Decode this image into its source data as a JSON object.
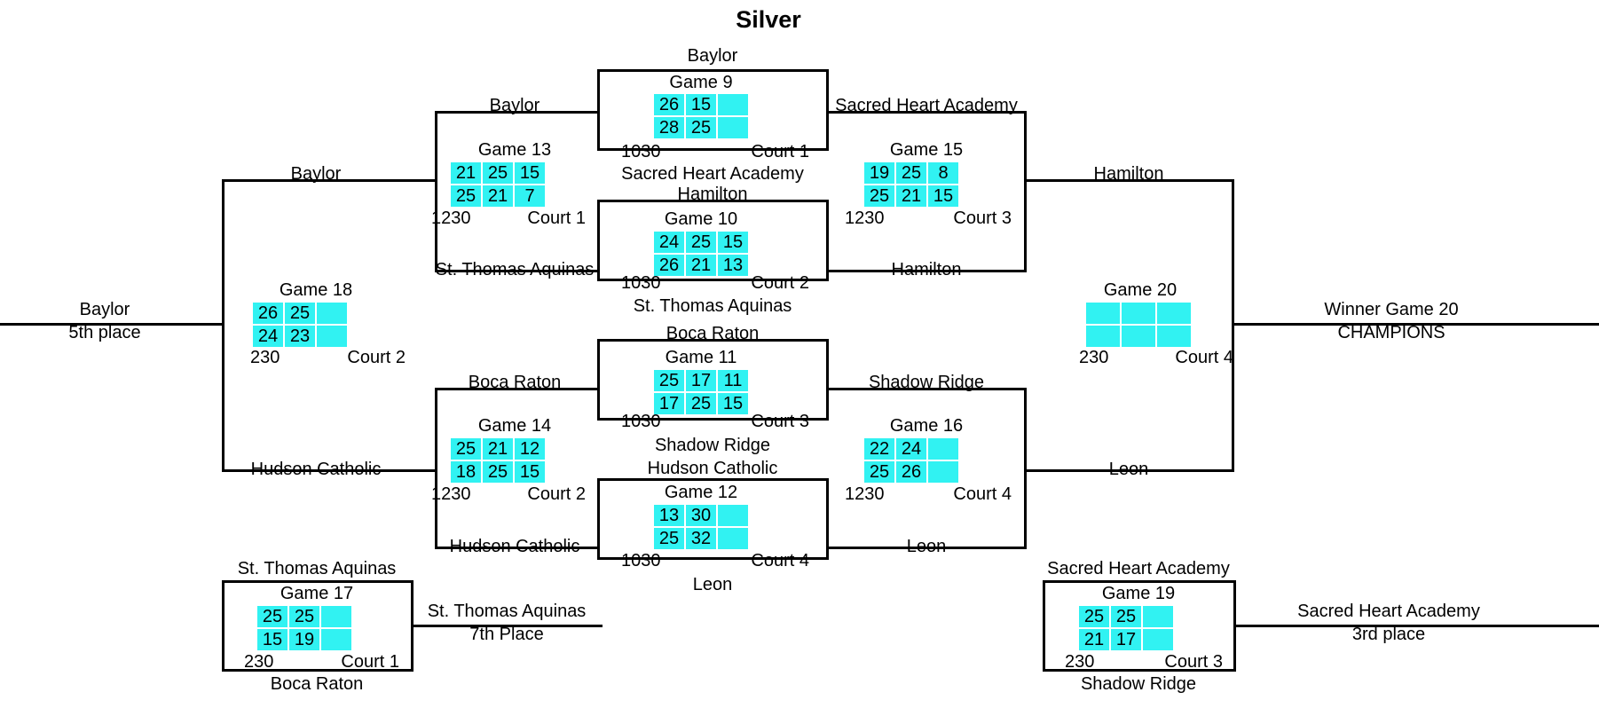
{
  "bracket": {
    "title": "Silver",
    "games": [
      {
        "id": "game-9",
        "label": "Game 9",
        "top_team": "Baylor",
        "bottom_team": "Sacred Heart Academy",
        "time": "1030",
        "court": "Court 1",
        "scores_top": [
          "26",
          "15",
          ""
        ],
        "scores_bottom": [
          "28",
          "25",
          ""
        ]
      },
      {
        "id": "game-10",
        "label": "Game 10",
        "top_team": "Hamilton",
        "bottom_team": "St. Thomas Aquinas",
        "time": "1030",
        "court": "Court 2",
        "scores_top": [
          "24",
          "25",
          "15"
        ],
        "scores_bottom": [
          "26",
          "21",
          "13"
        ]
      },
      {
        "id": "game-11",
        "label": "Game 11",
        "top_team": "Boca Raton",
        "bottom_team": "Shadow Ridge",
        "time": "1030",
        "court": "Court 3",
        "scores_top": [
          "25",
          "17",
          "11"
        ],
        "scores_bottom": [
          "17",
          "25",
          "15"
        ]
      },
      {
        "id": "game-12",
        "label": "Game 12",
        "top_team": "Hudson Catholic",
        "bottom_team": "Leon",
        "time": "1030",
        "court": "Court 4",
        "scores_top": [
          "13",
          "30",
          ""
        ],
        "scores_bottom": [
          "25",
          "32",
          ""
        ]
      },
      {
        "id": "game-13",
        "label": "Game 13",
        "top_team": "Baylor",
        "bottom_team": "St. Thomas Aquinas",
        "time": "1230",
        "court": "Court 1",
        "scores_top": [
          "21",
          "25",
          "15"
        ],
        "scores_bottom": [
          "25",
          "21",
          "7"
        ]
      },
      {
        "id": "game-14",
        "label": "Game 14",
        "top_team": "Boca Raton",
        "bottom_team": "Hudson Catholic",
        "time": "1230",
        "court": "Court 2",
        "scores_top": [
          "25",
          "21",
          "12"
        ],
        "scores_bottom": [
          "18",
          "25",
          "15"
        ]
      },
      {
        "id": "game-15",
        "label": "Game 15",
        "top_team": "Sacred Heart Academy",
        "bottom_team": "Hamilton",
        "time": "1230",
        "court": "Court 3",
        "scores_top": [
          "19",
          "25",
          "8"
        ],
        "scores_bottom": [
          "25",
          "21",
          "15"
        ]
      },
      {
        "id": "game-16",
        "label": "Game 16",
        "top_team": "Shadow Ridge",
        "bottom_team": "Leon",
        "time": "1230",
        "court": "Court 4",
        "scores_top": [
          "22",
          "24",
          ""
        ],
        "scores_bottom": [
          "25",
          "26",
          ""
        ]
      },
      {
        "id": "game-17",
        "label": "Game 17",
        "top_team": "St. Thomas Aquinas",
        "bottom_team": "Boca Raton",
        "time": "230",
        "court": "Court 1",
        "scores_top": [
          "25",
          "25",
          ""
        ],
        "scores_bottom": [
          "15",
          "19",
          ""
        ]
      },
      {
        "id": "game-18",
        "label": "Game 18",
        "top_team": "Baylor",
        "bottom_team": "Hudson Catholic",
        "time": "230",
        "court": "Court 2",
        "scores_top": [
          "26",
          "25",
          ""
        ],
        "scores_bottom": [
          "24",
          "23",
          ""
        ]
      },
      {
        "id": "game-19",
        "label": "Game 19",
        "top_team": "Sacred Heart Academy",
        "bottom_team": "Shadow Ridge",
        "time": "230",
        "court": "Court 3",
        "scores_top": [
          "25",
          "25",
          ""
        ],
        "scores_bottom": [
          "21",
          "17",
          ""
        ]
      },
      {
        "id": "game-20",
        "label": "Game 20",
        "top_team": "Hamilton",
        "bottom_team": "Leon",
        "time": "230",
        "court": "Court 4",
        "scores_top": [
          "",
          "",
          ""
        ],
        "scores_bottom": [
          "",
          "",
          ""
        ]
      }
    ],
    "outcomes": {
      "fifth_place_team": "Baylor",
      "fifth_place_label": "5th place",
      "seventh_place_team": "St. Thomas Aquinas",
      "seventh_place_label": "7th Place",
      "third_place_team": "Sacred Heart Academy",
      "third_place_label": "3rd place",
      "champion_team": "Winner Game 20",
      "champion_label": "CHAMPIONS"
    }
  },
  "colors": {
    "score_cell": "#31f2f2",
    "line": "#000000",
    "background": "#ffffff"
  }
}
